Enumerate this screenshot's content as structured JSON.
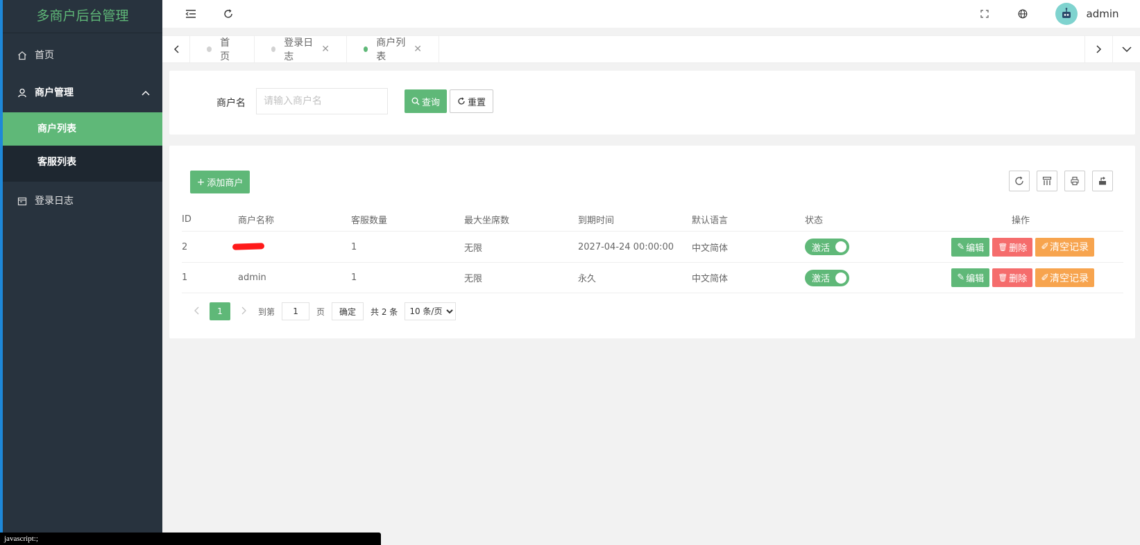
{
  "app": {
    "title": "多商户后台管理"
  },
  "sidebar": {
    "items": [
      {
        "label": "首页",
        "icon": "home-icon"
      },
      {
        "label": "商户管理",
        "icon": "user-icon",
        "open": true,
        "children": [
          {
            "label": "商户列表",
            "active": true
          },
          {
            "label": "客服列表"
          }
        ]
      },
      {
        "label": "登录日志",
        "icon": "calendar-icon"
      }
    ]
  },
  "header": {
    "username": "admin"
  },
  "tabs": [
    {
      "label": "首页",
      "closable": false
    },
    {
      "label": "登录日志",
      "closable": true
    },
    {
      "label": "商户列表",
      "closable": true,
      "active": true
    }
  ],
  "search": {
    "label": "商户名",
    "placeholder": "请输入商户名",
    "value": "",
    "query_label": "查询",
    "reset_label": "重置"
  },
  "toolbar": {
    "add_label": "添加商户"
  },
  "table": {
    "columns": [
      "ID",
      "商户名称",
      "客服数量",
      "最大坐席数",
      "到期时间",
      "默认语言",
      "状态",
      "操作"
    ],
    "rows": [
      {
        "id": "2",
        "name": "",
        "name_redacted": true,
        "agents": "1",
        "max_seats": "无限",
        "expire": "2027-04-24 00:00:00",
        "lang": "中文简体",
        "status": "激活",
        "status_on": true
      },
      {
        "id": "1",
        "name": "admin",
        "name_redacted": false,
        "agents": "1",
        "max_seats": "无限",
        "expire": "永久",
        "lang": "中文简体",
        "status": "激活",
        "status_on": true
      }
    ],
    "actions": {
      "edit": "编辑",
      "delete": "删除",
      "clear": "清空记录"
    }
  },
  "pager": {
    "current": "1",
    "goto_prefix": "到第",
    "goto_value": "1",
    "goto_suffix": "页",
    "confirm": "确定",
    "total": "共 2 条",
    "page_size": "10 条/页",
    "page_size_options": [
      "10 条/页"
    ]
  },
  "statusbar": {
    "text": "javascript:;"
  },
  "colors": {
    "sidebar": "#28333e",
    "accent": "#5fb878",
    "danger": "#f56c6c",
    "warn": "#f7a44e",
    "redaction": "#ff1a1a"
  }
}
